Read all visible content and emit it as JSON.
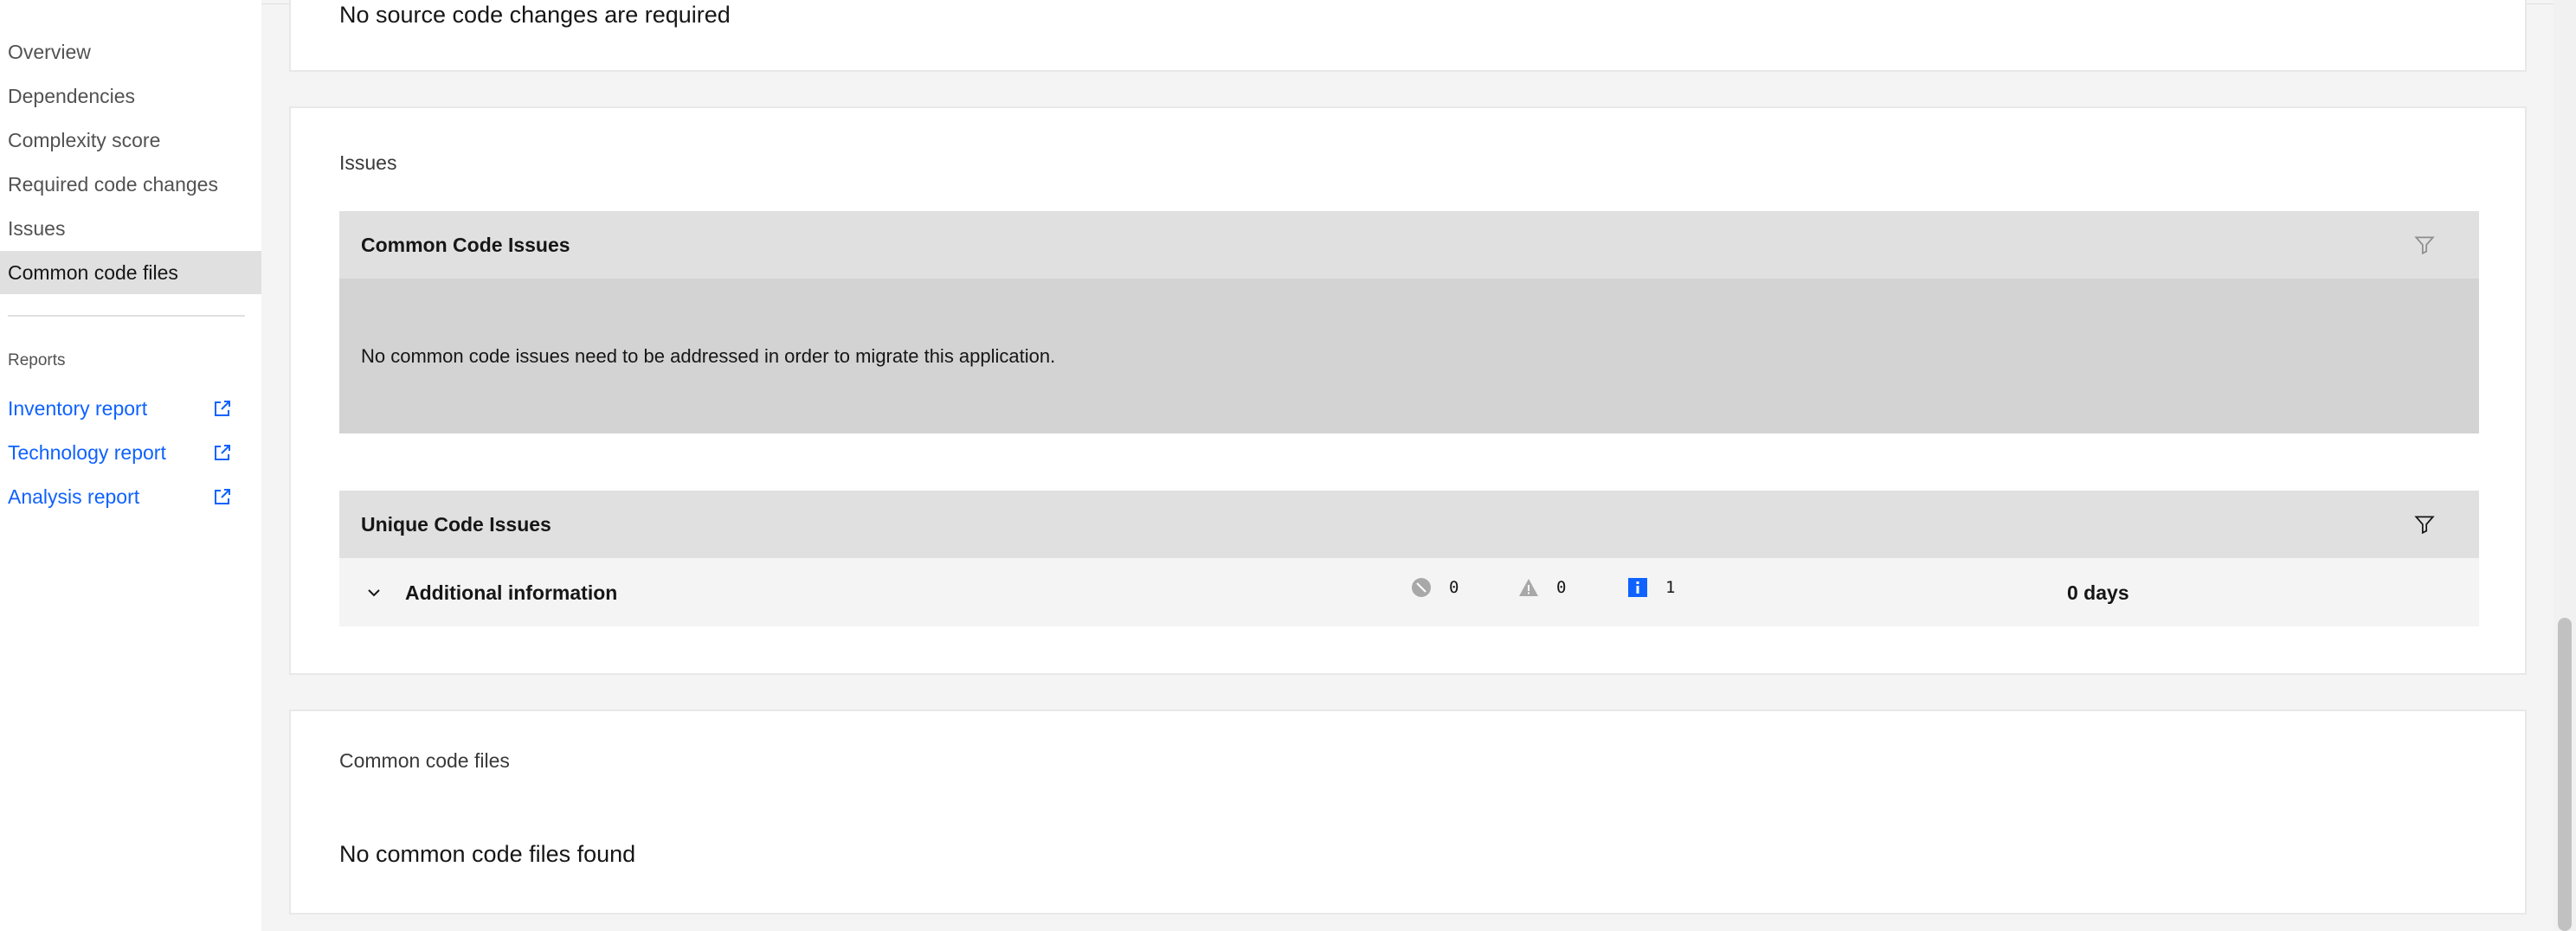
{
  "sidebar": {
    "items": [
      {
        "label": "Overview",
        "active": false
      },
      {
        "label": "Dependencies",
        "active": false
      },
      {
        "label": "Complexity score",
        "active": false
      },
      {
        "label": "Required code changes",
        "active": false
      },
      {
        "label": "Issues",
        "active": false
      },
      {
        "label": "Common code files",
        "active": true
      }
    ],
    "reports_heading": "Reports",
    "reports": [
      {
        "label": "Inventory report",
        "icon": "external-link-icon"
      },
      {
        "label": "Technology report",
        "icon": "external-link-icon"
      },
      {
        "label": "Analysis report",
        "icon": "external-link-icon"
      }
    ]
  },
  "required_changes": {
    "text": "No source code changes are required"
  },
  "issues": {
    "title": "Issues",
    "common": {
      "header": "Common Code Issues",
      "empty_message": "No common code issues need to be addressed in order to migrate this application."
    },
    "unique": {
      "header": "Unique Code Issues",
      "rows": [
        {
          "label": "Additional information",
          "critical_count": "0",
          "warning_count": "0",
          "info_count": "1",
          "effort": "0 days"
        }
      ]
    }
  },
  "common_files": {
    "title": "Common code files",
    "empty_message": "No common code files found"
  },
  "colors": {
    "link": "#0f62fe",
    "info_badge": "#0f62fe",
    "status_grey": "#a8a8a8"
  }
}
